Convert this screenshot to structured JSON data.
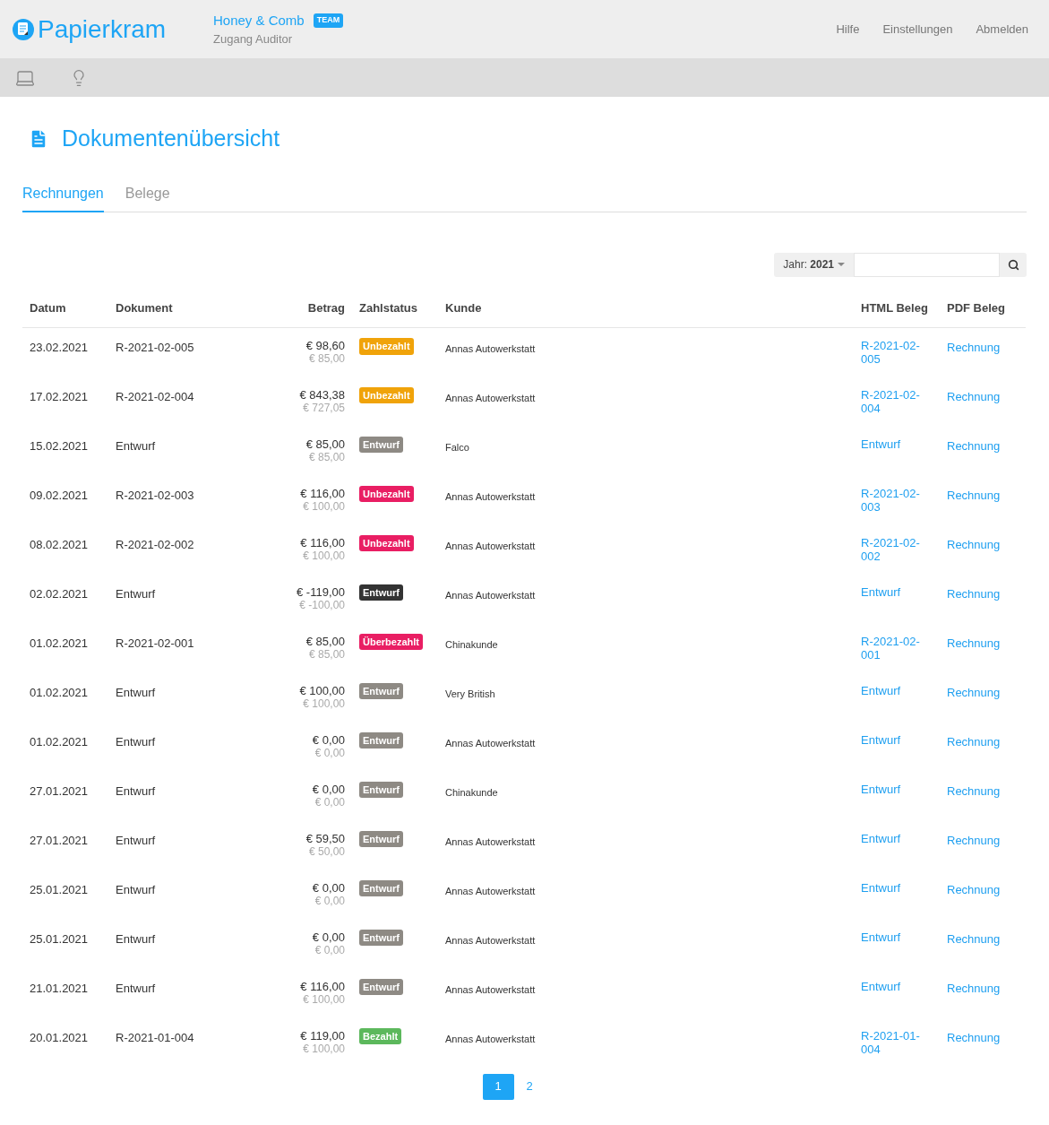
{
  "header": {
    "logo": "Papierkram",
    "company": "Honey & Comb",
    "badge": "TEAM",
    "access": "Zugang Auditor",
    "nav": [
      "Hilfe",
      "Einstellungen",
      "Abmelden"
    ]
  },
  "page": {
    "title": "Dokumentenübersicht"
  },
  "tabs": [
    {
      "label": "Rechnungen",
      "selected": true
    },
    {
      "label": "Belege",
      "selected": false
    }
  ],
  "filter": {
    "year": "Jahr: **2021**"
  },
  "table": {
    "columns": [
      "Datum",
      "Dokument",
      "Betrag",
      "Zahlstatus",
      "Kunde",
      "HTML Beleg",
      "PDF Beleg"
    ],
    "rows": [
      {
        "date": "23.02.2021",
        "document": "R-2021-02-005",
        "amount": "€ 98,60",
        "net": "€ 85,00",
        "status": {
          "label": "Unbezahlt",
          "color": "#f0a30a"
        },
        "customer": "Annas Autowerkstatt",
        "html": "R-2021-02-005",
        "pdf": "Rechnung"
      },
      {
        "date": "17.02.2021",
        "document": "R-2021-02-004",
        "amount": "€ 843,38",
        "net": "€ 727,05",
        "status": {
          "label": "Unbezahlt",
          "color": "#f0a30a"
        },
        "customer": "Annas Autowerkstatt",
        "html": "R-2021-02-004",
        "pdf": "Rechnung"
      },
      {
        "date": "15.02.2021",
        "document": "Entwurf",
        "amount": "€ 85,00",
        "net": "€ 85,00",
        "status": {
          "label": "Entwurf",
          "color": "#8e8a84"
        },
        "customer": "Falco",
        "html": "Entwurf",
        "pdf": "Rechnung"
      },
      {
        "date": "09.02.2021",
        "document": "R-2021-02-003",
        "amount": "€ 116,00",
        "net": "€ 100,00",
        "status": {
          "label": "Unbezahlt",
          "color": "#e91e63"
        },
        "customer": "Annas Autowerkstatt",
        "html": "R-2021-02-003",
        "pdf": "Rechnung"
      },
      {
        "date": "08.02.2021",
        "document": "R-2021-02-002",
        "amount": "€ 116,00",
        "net": "€ 100,00",
        "status": {
          "label": "Unbezahlt",
          "color": "#e91e63"
        },
        "customer": "Annas Autowerkstatt",
        "html": "R-2021-02-002",
        "pdf": "Rechnung"
      },
      {
        "date": "02.02.2021",
        "document": "Entwurf",
        "amount": "€ -119,00",
        "net": "€ -100,00",
        "status": {
          "label": "Entwurf",
          "color": "#333333"
        },
        "customer": "Annas Autowerkstatt",
        "html": "Entwurf",
        "pdf": "Rechnung"
      },
      {
        "date": "01.02.2021",
        "document": "R-2021-02-001",
        "amount": "€ 85,00",
        "net": "€ 85,00",
        "status": {
          "label": "Überbezahlt",
          "color": "#e91e63"
        },
        "customer": "Chinakunde",
        "html": "R-2021-02-001",
        "pdf": "Rechnung"
      },
      {
        "date": "01.02.2021",
        "document": "Entwurf",
        "amount": "€ 100,00",
        "net": "€ 100,00",
        "status": {
          "label": "Entwurf",
          "color": "#8e8a84"
        },
        "customer": "Very British",
        "html": "Entwurf",
        "pdf": "Rechnung"
      },
      {
        "date": "01.02.2021",
        "document": "Entwurf",
        "amount": "€ 0,00",
        "net": "€ 0,00",
        "status": {
          "label": "Entwurf",
          "color": "#8e8a84"
        },
        "customer": "Annas Autowerkstatt",
        "html": "Entwurf",
        "pdf": "Rechnung"
      },
      {
        "date": "27.01.2021",
        "document": "Entwurf",
        "amount": "€ 0,00",
        "net": "€ 0,00",
        "status": {
          "label": "Entwurf",
          "color": "#8e8a84"
        },
        "customer": "Chinakunde",
        "html": "Entwurf",
        "pdf": "Rechnung"
      },
      {
        "date": "27.01.2021",
        "document": "Entwurf",
        "amount": "€ 59,50",
        "net": "€ 50,00",
        "status": {
          "label": "Entwurf",
          "color": "#8e8a84"
        },
        "customer": "Annas Autowerkstatt",
        "html": "Entwurf",
        "pdf": "Rechnung"
      },
      {
        "date": "25.01.2021",
        "document": "Entwurf",
        "amount": "€ 0,00",
        "net": "€ 0,00",
        "status": {
          "label": "Entwurf",
          "color": "#8e8a84"
        },
        "customer": "Annas Autowerkstatt",
        "html": "Entwurf",
        "pdf": "Rechnung"
      },
      {
        "date": "25.01.2021",
        "document": "Entwurf",
        "amount": "€ 0,00",
        "net": "€ 0,00",
        "status": {
          "label": "Entwurf",
          "color": "#8e8a84"
        },
        "customer": "Annas Autowerkstatt",
        "html": "Entwurf",
        "pdf": "Rechnung"
      },
      {
        "date": "21.01.2021",
        "document": "Entwurf",
        "amount": "€ 116,00",
        "net": "€ 100,00",
        "status": {
          "label": "Entwurf",
          "color": "#8e8a84"
        },
        "customer": "Annas Autowerkstatt",
        "html": "Entwurf",
        "pdf": "Rechnung"
      },
      {
        "date": "20.01.2021",
        "document": "R-2021-01-004",
        "amount": "€ 119,00",
        "net": "€ 100,00",
        "status": {
          "label": "Bezahlt",
          "color": "#5cb85c"
        },
        "customer": "Annas Autowerkstatt",
        "html": "R-2021-01-004",
        "pdf": "Rechnung"
      }
    ]
  },
  "pagination": [
    {
      "label": "1",
      "selected": true
    },
    {
      "label": "2",
      "selected": false
    }
  ]
}
